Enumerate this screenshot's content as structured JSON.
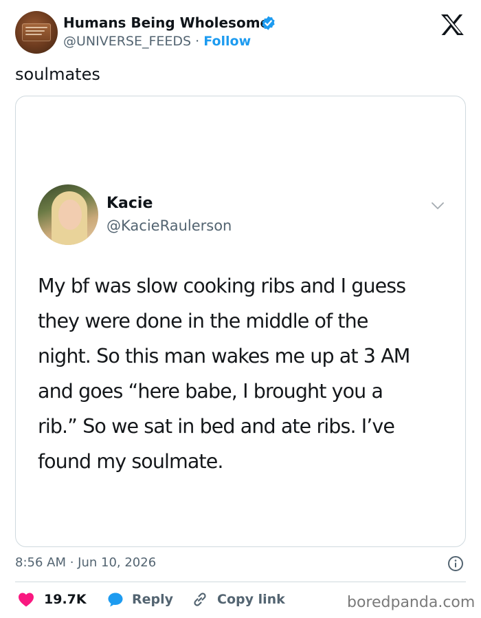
{
  "post": {
    "author": {
      "display_name": "Humans Being Wholesome",
      "handle": "@UNIVERSE_FEEDS",
      "separator": "·",
      "follow_label": "Follow"
    },
    "text": "soulmates",
    "embedded_tweet": {
      "name": "Kacie",
      "handle": "@KacieRaulerson",
      "body_lines": [
        "My bf was slow cooking ribs and I guess",
        "they were done in the middle of the",
        "night. So this man wakes me up at 3 AM",
        "and goes “here babe, I brought you a",
        "rib.” So we sat in bed and ate ribs. I’ve",
        "found my soulmate."
      ]
    },
    "timestamp": "8:56 AM · Jun 10, 2026",
    "actions": {
      "likes_count": "19.7K",
      "reply_label": "Reply",
      "copy_link_label": "Copy link"
    }
  },
  "watermark": "boredpanda.com",
  "colors": {
    "accent": "#1d9bf0",
    "like": "#f91880",
    "text_primary": "#0f1419",
    "text_secondary": "#536471",
    "border": "#cfd9de"
  },
  "icons": [
    "verified-badge-icon",
    "x-logo-icon",
    "chevron-down-icon",
    "info-icon",
    "heart-icon",
    "reply-bubble-icon",
    "link-icon"
  ]
}
